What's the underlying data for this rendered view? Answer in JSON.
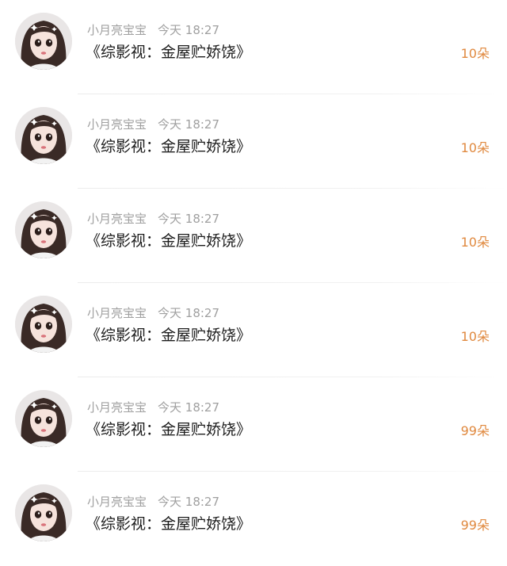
{
  "messages": [
    {
      "sender": "小月亮宝宝",
      "time": "今天 18:27",
      "title": "《综影视：金屋贮娇饶》",
      "gift": "10朵"
    },
    {
      "sender": "小月亮宝宝",
      "time": "今天 18:27",
      "title": "《综影视：金屋贮娇饶》",
      "gift": "10朵"
    },
    {
      "sender": "小月亮宝宝",
      "time": "今天 18:27",
      "title": "《综影视：金屋贮娇饶》",
      "gift": "10朵"
    },
    {
      "sender": "小月亮宝宝",
      "time": "今天 18:27",
      "title": "《综影视：金屋贮娇饶》",
      "gift": "10朵"
    },
    {
      "sender": "小月亮宝宝",
      "time": "今天 18:27",
      "title": "《综影视：金屋贮娇饶》",
      "gift": "99朵"
    },
    {
      "sender": "小月亮宝宝",
      "time": "今天 18:27",
      "title": "《综影视：金屋贮娇饶》",
      "gift": "99朵"
    }
  ],
  "colors": {
    "sender": "#a0a0a0",
    "title": "#1c1c1c",
    "gift": "#e0893f",
    "divider": "#ececec"
  },
  "icons": {
    "avatar": "cartoon-girl-avatar-icon"
  }
}
